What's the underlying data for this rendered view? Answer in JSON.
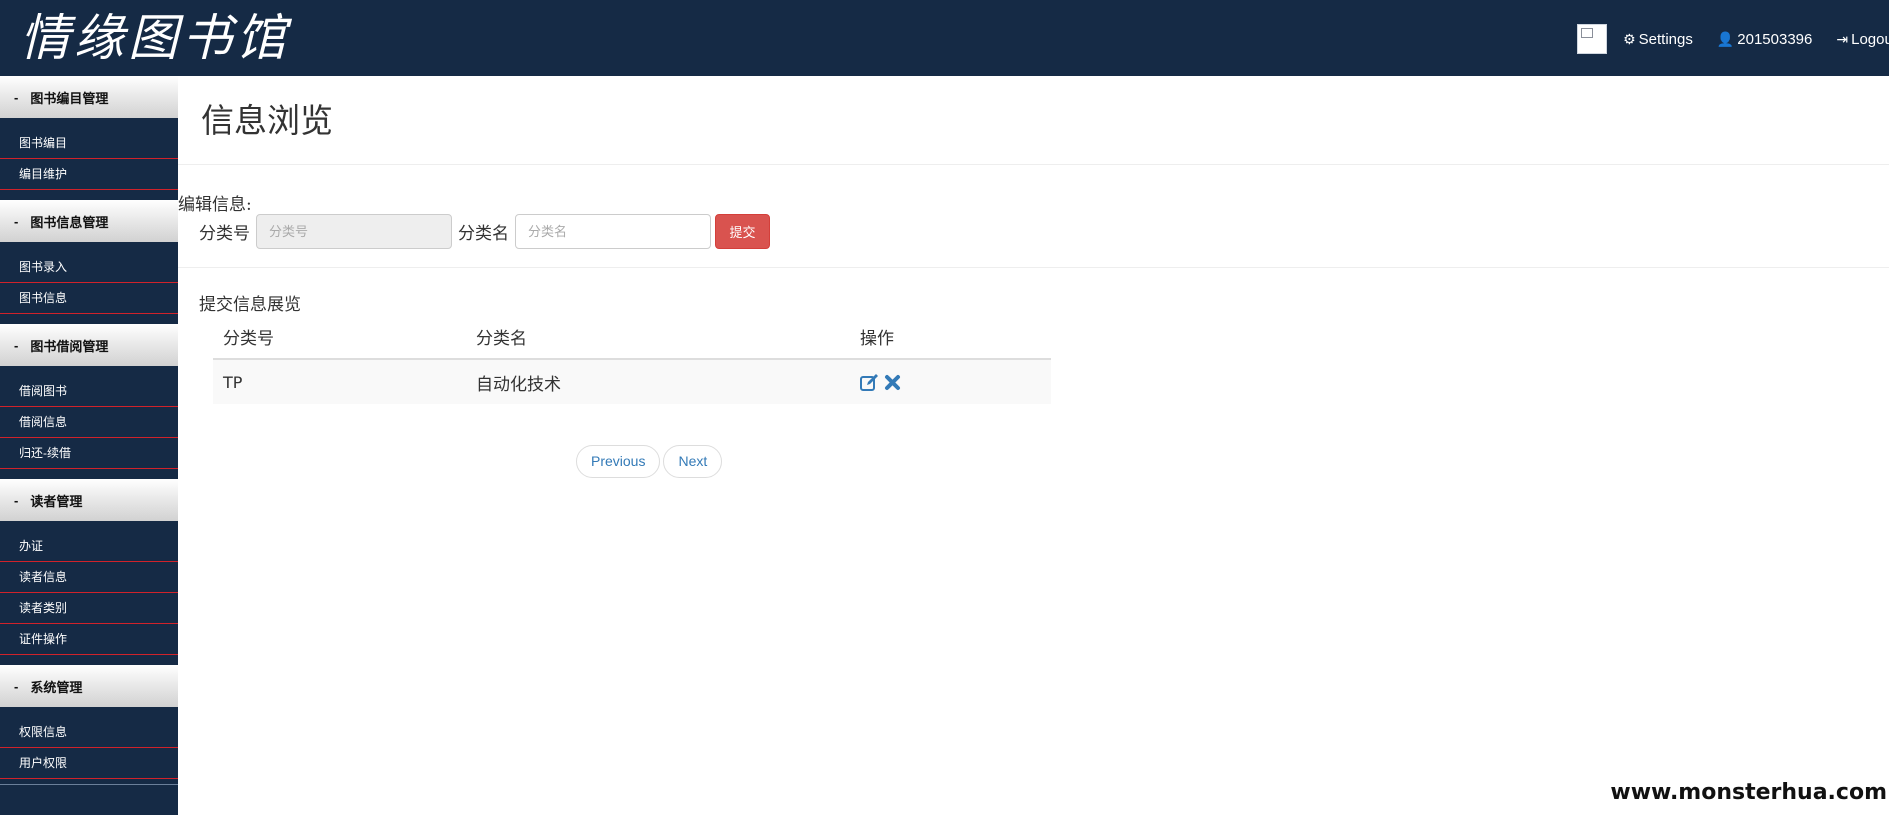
{
  "header": {
    "logo_text": "情缘图书馆",
    "settings_label": "Settings",
    "user_label": "201503396",
    "logout_label": "Logout"
  },
  "sidebar": {
    "sections": [
      {
        "title": "图书编目管理",
        "items": [
          "图书编目",
          "编目维护"
        ]
      },
      {
        "title": "图书信息管理",
        "items": [
          "图书录入",
          "图书信息"
        ]
      },
      {
        "title": "图书借阅管理",
        "items": [
          "借阅图书",
          "借阅信息",
          "归还-续借"
        ]
      },
      {
        "title": "读者管理",
        "items": [
          "办证",
          "读者信息",
          "读者类别",
          "证件操作"
        ]
      },
      {
        "title": "系统管理",
        "items": [
          "权限信息",
          "用户权限"
        ]
      }
    ]
  },
  "main": {
    "page_title": "信息浏览",
    "edit_label": "编辑信息:",
    "form": {
      "code_label": "分类号",
      "code_placeholder": "分类号",
      "name_label": "分类名",
      "name_placeholder": "分类名",
      "submit_label": "提交"
    },
    "table_caption": "提交信息展览",
    "table": {
      "headers": [
        "分类号",
        "分类名",
        "操作"
      ],
      "rows": [
        {
          "code": "TP",
          "name": "自动化技术"
        }
      ]
    },
    "pagination": {
      "previous": "Previous",
      "next": "Next"
    }
  },
  "watermark": "www.monsterhua.com",
  "colors": {
    "header_bg": "#152a45",
    "sidebar_divider": "#d0222a",
    "submit_button": "#d9534f",
    "link": "#337ab7"
  }
}
